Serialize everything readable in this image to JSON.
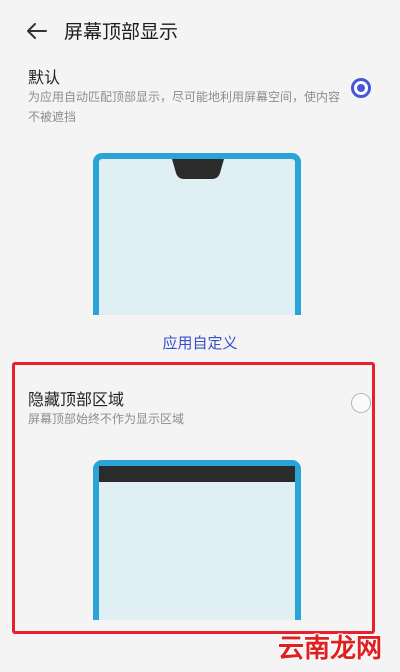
{
  "header": {
    "title": "屏幕顶部显示"
  },
  "options": [
    {
      "title": "默认",
      "description": "为应用自动匹配顶部显示，尽可能地利用屏幕空间，使内容不被遮挡",
      "selected": true
    },
    {
      "title": "隐藏顶部区域",
      "description": "屏幕顶部始终不作为显示区域",
      "selected": false
    }
  ],
  "custom_link": "应用自定义",
  "watermark": {
    "text": "云南龙网"
  },
  "colors": {
    "accent": "#4857d9",
    "frame": "#2aa3d8",
    "highlight": "#e8202b"
  }
}
